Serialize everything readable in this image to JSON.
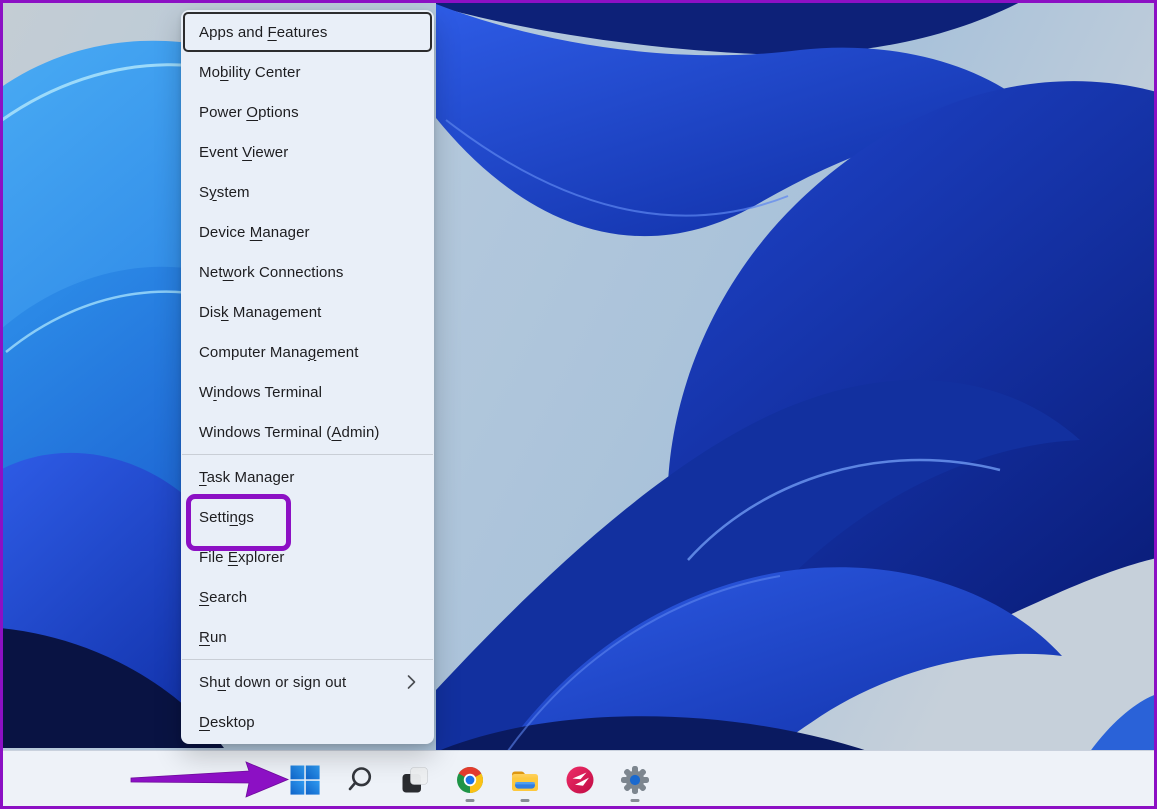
{
  "menu": {
    "items": [
      {
        "label": "Apps and Features",
        "mnemonic": "F",
        "focused": true
      },
      {
        "label": "Mobility Center",
        "mnemonic": "b"
      },
      {
        "label": "Power Options",
        "mnemonic": "O"
      },
      {
        "label": "Event Viewer",
        "mnemonic": "V"
      },
      {
        "label": "System",
        "mnemonic": "y"
      },
      {
        "label": "Device Manager",
        "mnemonic": "M"
      },
      {
        "label": "Network Connections",
        "mnemonic": "w"
      },
      {
        "label": "Disk Management",
        "mnemonic": "k"
      },
      {
        "label": "Computer Management",
        "mnemonic": "g"
      },
      {
        "label": "Windows Terminal",
        "mnemonic": "i"
      },
      {
        "label": "Windows Terminal (Admin)",
        "mnemonic": "A"
      },
      {
        "label": "Task Manager",
        "mnemonic": "T",
        "separator_before": true
      },
      {
        "label": "Settings",
        "mnemonic": "n",
        "annotated": true
      },
      {
        "label": "File Explorer",
        "mnemonic": "E"
      },
      {
        "label": "Search",
        "mnemonic": "S"
      },
      {
        "label": "Run",
        "mnemonic": "R"
      },
      {
        "label": "Shut down or sign out",
        "mnemonic": "u",
        "separator_before": true,
        "has_submenu": true
      },
      {
        "label": "Desktop",
        "mnemonic": "D"
      }
    ]
  },
  "taskbar": {
    "icons": [
      {
        "name": "start",
        "running": false
      },
      {
        "name": "search",
        "running": false
      },
      {
        "name": "task-view",
        "running": false
      },
      {
        "name": "chrome",
        "running": true
      },
      {
        "name": "file-explorer",
        "running": true
      },
      {
        "name": "skitch",
        "running": false
      },
      {
        "name": "settings",
        "running": true
      }
    ]
  },
  "annotations": {
    "highlighted_menu_item": "Settings",
    "arrow_target": "start-button"
  },
  "colors": {
    "annotation_purple": "#8c10c4",
    "menu_background": "#e9eff8",
    "menu_text": "#1d1d20",
    "focus_ring": "#2c2c2e",
    "taskbar_background": "#eef2f8",
    "start_blue": "#1474d4",
    "gear_gray": "#7d868f",
    "gear_blue": "#1b69ce",
    "skitch_red": "#d5154e",
    "wallpaper_royal_blue": "#1f46cf",
    "wallpaper_azure": "#2e90ea",
    "wallpaper_sky": "#b3c8dc"
  }
}
